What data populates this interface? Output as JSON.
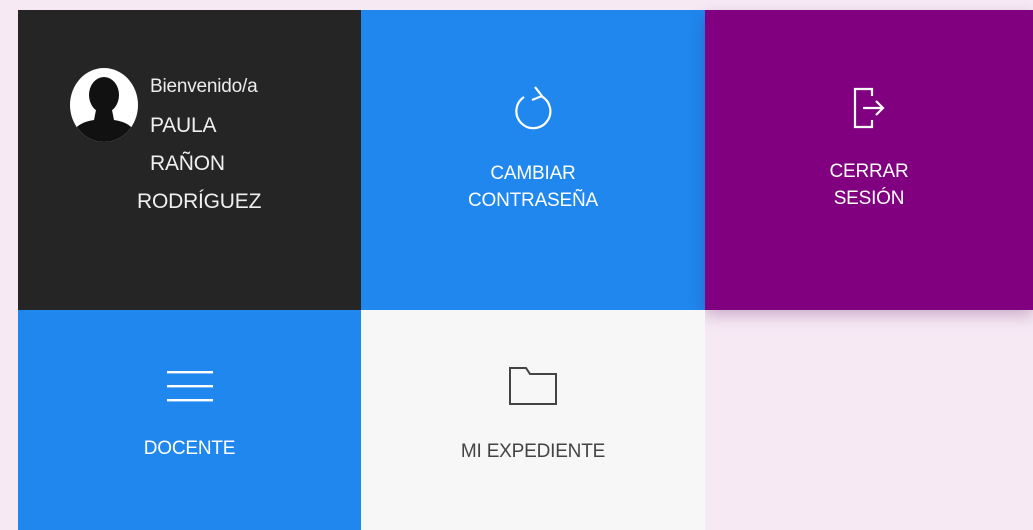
{
  "user_tile": {
    "welcome": "Bienvenido/a",
    "name_lines": [
      "PAULA",
      "RAÑON",
      "RODRÍGUEZ"
    ],
    "avatar_icon": "user-silhouette-icon"
  },
  "tiles": {
    "change_password": {
      "label_line1": "CAMBIAR",
      "label_line2": "CONTRASEÑA",
      "icon": "refresh-icon",
      "color": "#1f87ee"
    },
    "logout": {
      "label_line1": "CERRAR",
      "label_line2": "SESIÓN",
      "icon": "logout-icon",
      "color": "#800080"
    },
    "teacher": {
      "label": "DOCENTE",
      "icon": "menu-icon",
      "color": "#1f87ee"
    },
    "record": {
      "label": "MI EXPEDIENTE",
      "icon": "folder-icon",
      "color": "#f7f7f7"
    }
  },
  "colors": {
    "background": "#f6e9f4",
    "user_tile": "#252525"
  }
}
